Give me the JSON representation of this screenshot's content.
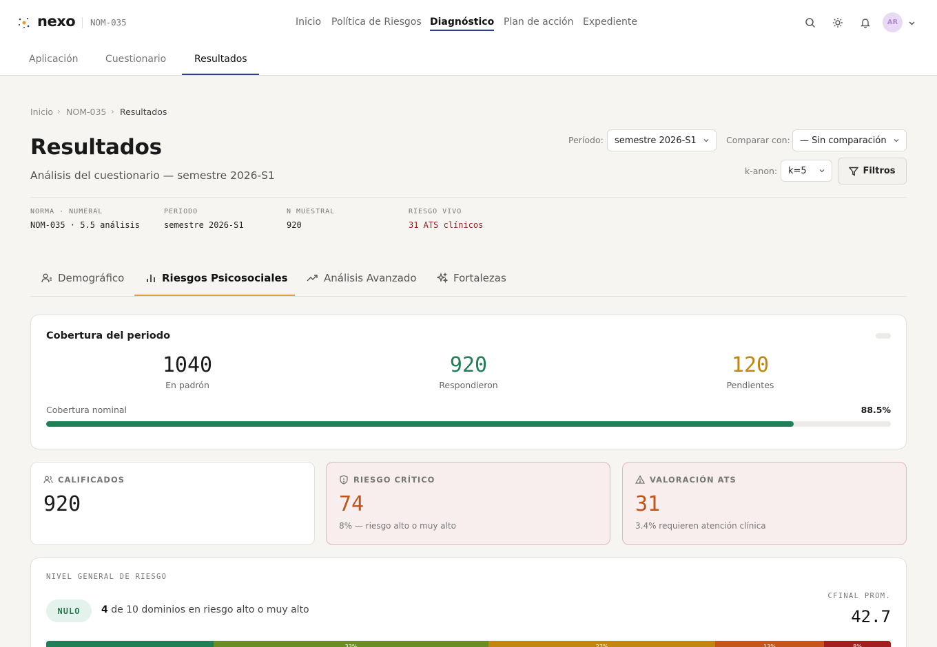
{
  "brand": {
    "name": "nexo",
    "subtitle": "NOM-035"
  },
  "main_nav": [
    "Inicio",
    "Política de Riesgos",
    "Diagnóstico",
    "Plan de acción",
    "Expediente"
  ],
  "user": {
    "initials": "AR"
  },
  "sub_tabs": [
    "Aplicación",
    "Cuestionario",
    "Resultados"
  ],
  "breadcrumb": [
    "Inicio",
    "NOM-035",
    "Resultados"
  ],
  "page": {
    "title": "Resultados",
    "subtitle": "Análisis del cuestionario — semestre 2026-S1"
  },
  "controls": {
    "period_label": "Período:",
    "period_value": "semestre 2026-S1",
    "compare_label": "Comparar con:",
    "compare_value": "— Sin comparación",
    "kanon_label": "k-anon:",
    "kanon_value": "k=5",
    "filters_label": "Filtros"
  },
  "meta": [
    {
      "key": "NORMA · NUMERAL",
      "value": "NOM-035 · 5.5 análisis"
    },
    {
      "key": "PERIODO",
      "value": "semestre 2026-S1"
    },
    {
      "key": "N MUESTRAL",
      "value": "920"
    },
    {
      "key": "RIESGO VIVO",
      "value": "31 ATS clínicos"
    }
  ],
  "section_tabs": [
    "Demográfico",
    "Riesgos Psicosociales",
    "Análisis Avanzado",
    "Fortalezas"
  ],
  "coverage": {
    "title": "Cobertura del periodo",
    "stats": [
      {
        "value": "1040",
        "label": "En padrón",
        "color": "#1a1a1a"
      },
      {
        "value": "920",
        "label": "Respondieron",
        "color": "#1f8057"
      },
      {
        "value": "120",
        "label": "Pendientes",
        "color": "#c2860e"
      }
    ],
    "nominal_label": "Cobertura nominal",
    "nominal_pct": "88.5%",
    "nominal_fraction": 0.885
  },
  "kpis": [
    {
      "label": "CALIFICADOS",
      "value": "920",
      "sub": ""
    },
    {
      "label": "RIESGO CRÍTICO",
      "value": "74",
      "sub": "8% — riesgo alto o muy alto"
    },
    {
      "label": "VALORACIÓN ATS",
      "value": "31",
      "sub": "3.4% requieren atención clínica"
    }
  ],
  "risk": {
    "heading": "NIVEL GENERAL DE RIESGO",
    "level": "NULO",
    "count": "4",
    "text": "de 10 dominios en riesgo alto o muy alto",
    "cfinal_label": "CFINAL PROM.",
    "cfinal_value": "42.7",
    "distribution": [
      {
        "label": "",
        "fraction": 0.198,
        "color": "#1f8057"
      },
      {
        "label": "33%",
        "fraction": 0.326,
        "color": "#6b8e23"
      },
      {
        "label": "27%",
        "fraction": 0.268,
        "color": "#c2860e"
      },
      {
        "label": "13%",
        "fraction": 0.129,
        "color": "#c9541a"
      },
      {
        "label": "8%",
        "fraction": 0.079,
        "color": "#a31e1e"
      }
    ]
  },
  "colors": {
    "accent": "#2c3e8f",
    "section_accent": "#e2a23b",
    "success": "#1f8057",
    "warning": "#c2860e",
    "danger": "#a31e1e"
  }
}
